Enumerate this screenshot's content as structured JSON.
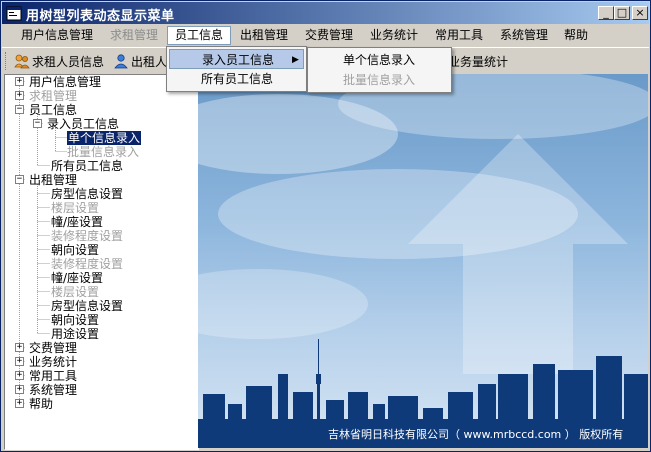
{
  "window": {
    "title": "用树型列表动态显示菜单",
    "buttons": {
      "minimize": "_",
      "maximize": "□",
      "close": "×"
    }
  },
  "menubar": [
    {
      "label": "用户信息管理",
      "disabled": false
    },
    {
      "label": "求租管理",
      "disabled": true
    },
    {
      "label": "员工信息",
      "disabled": false,
      "active": true
    },
    {
      "label": "出租管理",
      "disabled": false
    },
    {
      "label": "交费管理",
      "disabled": false
    },
    {
      "label": "业务统计",
      "disabled": false
    },
    {
      "label": "常用工具",
      "disabled": false
    },
    {
      "label": "系统管理",
      "disabled": false
    },
    {
      "label": "帮助",
      "disabled": false
    }
  ],
  "toolbar": {
    "items": [
      "求租人员信息",
      "出租人",
      "业务量统计"
    ]
  },
  "dropdown": {
    "items": [
      {
        "label": "录入员工信息",
        "has_submenu": true
      },
      {
        "label": "所有员工信息"
      }
    ],
    "submenu": [
      {
        "label": "单个信息录入",
        "disabled": false
      },
      {
        "label": "批量信息录入",
        "disabled": true
      }
    ],
    "submenu_arrow": "▶"
  },
  "tree": [
    {
      "label": "用户信息管理",
      "expander": "+",
      "disabled": false
    },
    {
      "label": "求租管理",
      "expander": "+",
      "disabled": true
    },
    {
      "label": "员工信息",
      "expander": "−",
      "disabled": false
    },
    {
      "label": "录入员工信息",
      "expander": "−",
      "disabled": false
    },
    {
      "label": "单个信息录入",
      "disabled": false,
      "selected": true
    },
    {
      "label": "批量信息录入",
      "disabled": true
    },
    {
      "label": "所有员工信息",
      "disabled": false
    },
    {
      "label": "出租管理",
      "expander": "−",
      "disabled": false
    },
    {
      "label": "房型信息设置",
      "disabled": false
    },
    {
      "label": "楼层设置",
      "disabled": true
    },
    {
      "label": "幢/座设置",
      "disabled": false
    },
    {
      "label": "装修程度设置",
      "disabled": true
    },
    {
      "label": "朝向设置",
      "disabled": false
    },
    {
      "label": "装修程度设置",
      "disabled": true
    },
    {
      "label": "幢/座设置",
      "disabled": false
    },
    {
      "label": "楼层设置",
      "disabled": true
    },
    {
      "label": "房型信息设置",
      "disabled": false
    },
    {
      "label": "朝向设置",
      "disabled": false
    },
    {
      "label": "用途设置",
      "disabled": false
    },
    {
      "label": "交费管理",
      "expander": "+",
      "disabled": false
    },
    {
      "label": "业务统计",
      "expander": "+",
      "disabled": false
    },
    {
      "label": "常用工具",
      "expander": "+",
      "disabled": false
    },
    {
      "label": "系统管理",
      "expander": "+",
      "disabled": false
    },
    {
      "label": "帮助",
      "expander": "+",
      "disabled": false
    }
  ],
  "footer": {
    "text": "吉林省明日科技有限公司（ www.mrbccd.com ） 版权所有"
  },
  "colors": {
    "titlebar": "#0a246a",
    "selection": "#0a246a",
    "city": "#0f3a7a",
    "sky": "#8db6dd"
  }
}
